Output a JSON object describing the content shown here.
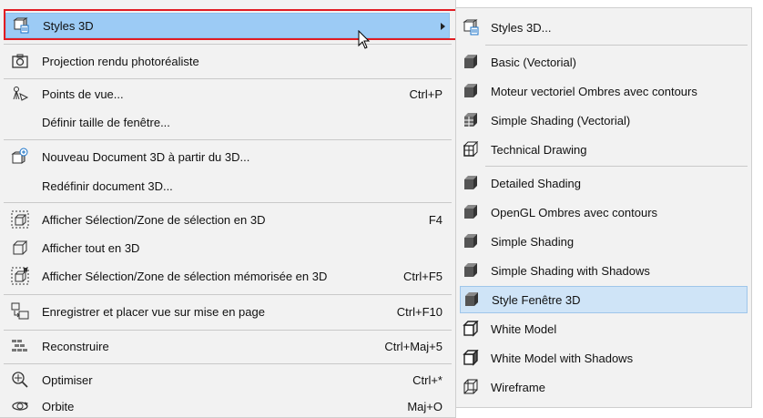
{
  "main_menu": {
    "items": [
      {
        "label": "Styles 3D",
        "shortcut": "",
        "icon": "styles-3d-icon"
      },
      {
        "label": "Projection rendu photoréaliste",
        "shortcut": "",
        "icon": "camera-icon"
      },
      {
        "label": "Points de vue...",
        "shortcut": "Ctrl+P",
        "icon": "viewpoints-icon"
      },
      {
        "label": "Définir taille de fenêtre...",
        "shortcut": "",
        "icon": ""
      },
      {
        "label": "Nouveau Document 3D à partir du 3D...",
        "shortcut": "",
        "icon": "new-3d-document-icon"
      },
      {
        "label": "Redéfinir document 3D...",
        "shortcut": "",
        "icon": ""
      },
      {
        "label": "Afficher Sélection/Zone de sélection en 3D",
        "shortcut": "F4",
        "icon": "show-selection-3d-icon"
      },
      {
        "label": "Afficher tout en 3D",
        "shortcut": "",
        "icon": "show-all-3d-icon"
      },
      {
        "label": "Afficher Sélection/Zone de sélection mémorisée en 3D",
        "shortcut": "Ctrl+F5",
        "icon": "show-stored-selection-3d-icon"
      },
      {
        "label": "Enregistrer et placer vue sur mise en page",
        "shortcut": "Ctrl+F10",
        "icon": "save-place-view-icon"
      },
      {
        "label": "Reconstruire",
        "shortcut": "Ctrl+Maj+5",
        "icon": "rebuild-icon"
      },
      {
        "label": "Optimiser",
        "shortcut": "Ctrl+*",
        "icon": "optimize-icon"
      },
      {
        "label": "Orbite",
        "shortcut": "Maj+O",
        "icon": "orbit-icon"
      }
    ]
  },
  "sub_menu": {
    "items": [
      {
        "label": "Styles 3D...",
        "icon": "styles-3d-icon"
      },
      {
        "label": "Basic (Vectorial)",
        "icon": "cube-shaded-icon"
      },
      {
        "label": "Moteur vectoriel Ombres avec contours",
        "icon": "cube-shaded-icon"
      },
      {
        "label": "Simple Shading (Vectorial)",
        "icon": "cube-hatched-icon"
      },
      {
        "label": "Technical Drawing",
        "icon": "cube-technical-icon"
      },
      {
        "label": "Detailed Shading",
        "icon": "cube-shaded-icon"
      },
      {
        "label": "OpenGL Ombres avec contours",
        "icon": "cube-shaded-icon"
      },
      {
        "label": "Simple Shading",
        "icon": "cube-shaded-icon"
      },
      {
        "label": "Simple Shading with Shadows",
        "icon": "cube-shaded-icon"
      },
      {
        "label": "Style Fenêtre 3D",
        "icon": "cube-shaded-icon"
      },
      {
        "label": "White Model",
        "icon": "cube-outline-icon"
      },
      {
        "label": "White Model with Shadows",
        "icon": "cube-outline-icon"
      },
      {
        "label": "Wireframe",
        "icon": "cube-wireframe-icon"
      }
    ]
  },
  "colors": {
    "highlight": "#9ccbf5",
    "annotation_frame": "#e11d23",
    "menu_bg": "#f2f2f2"
  }
}
